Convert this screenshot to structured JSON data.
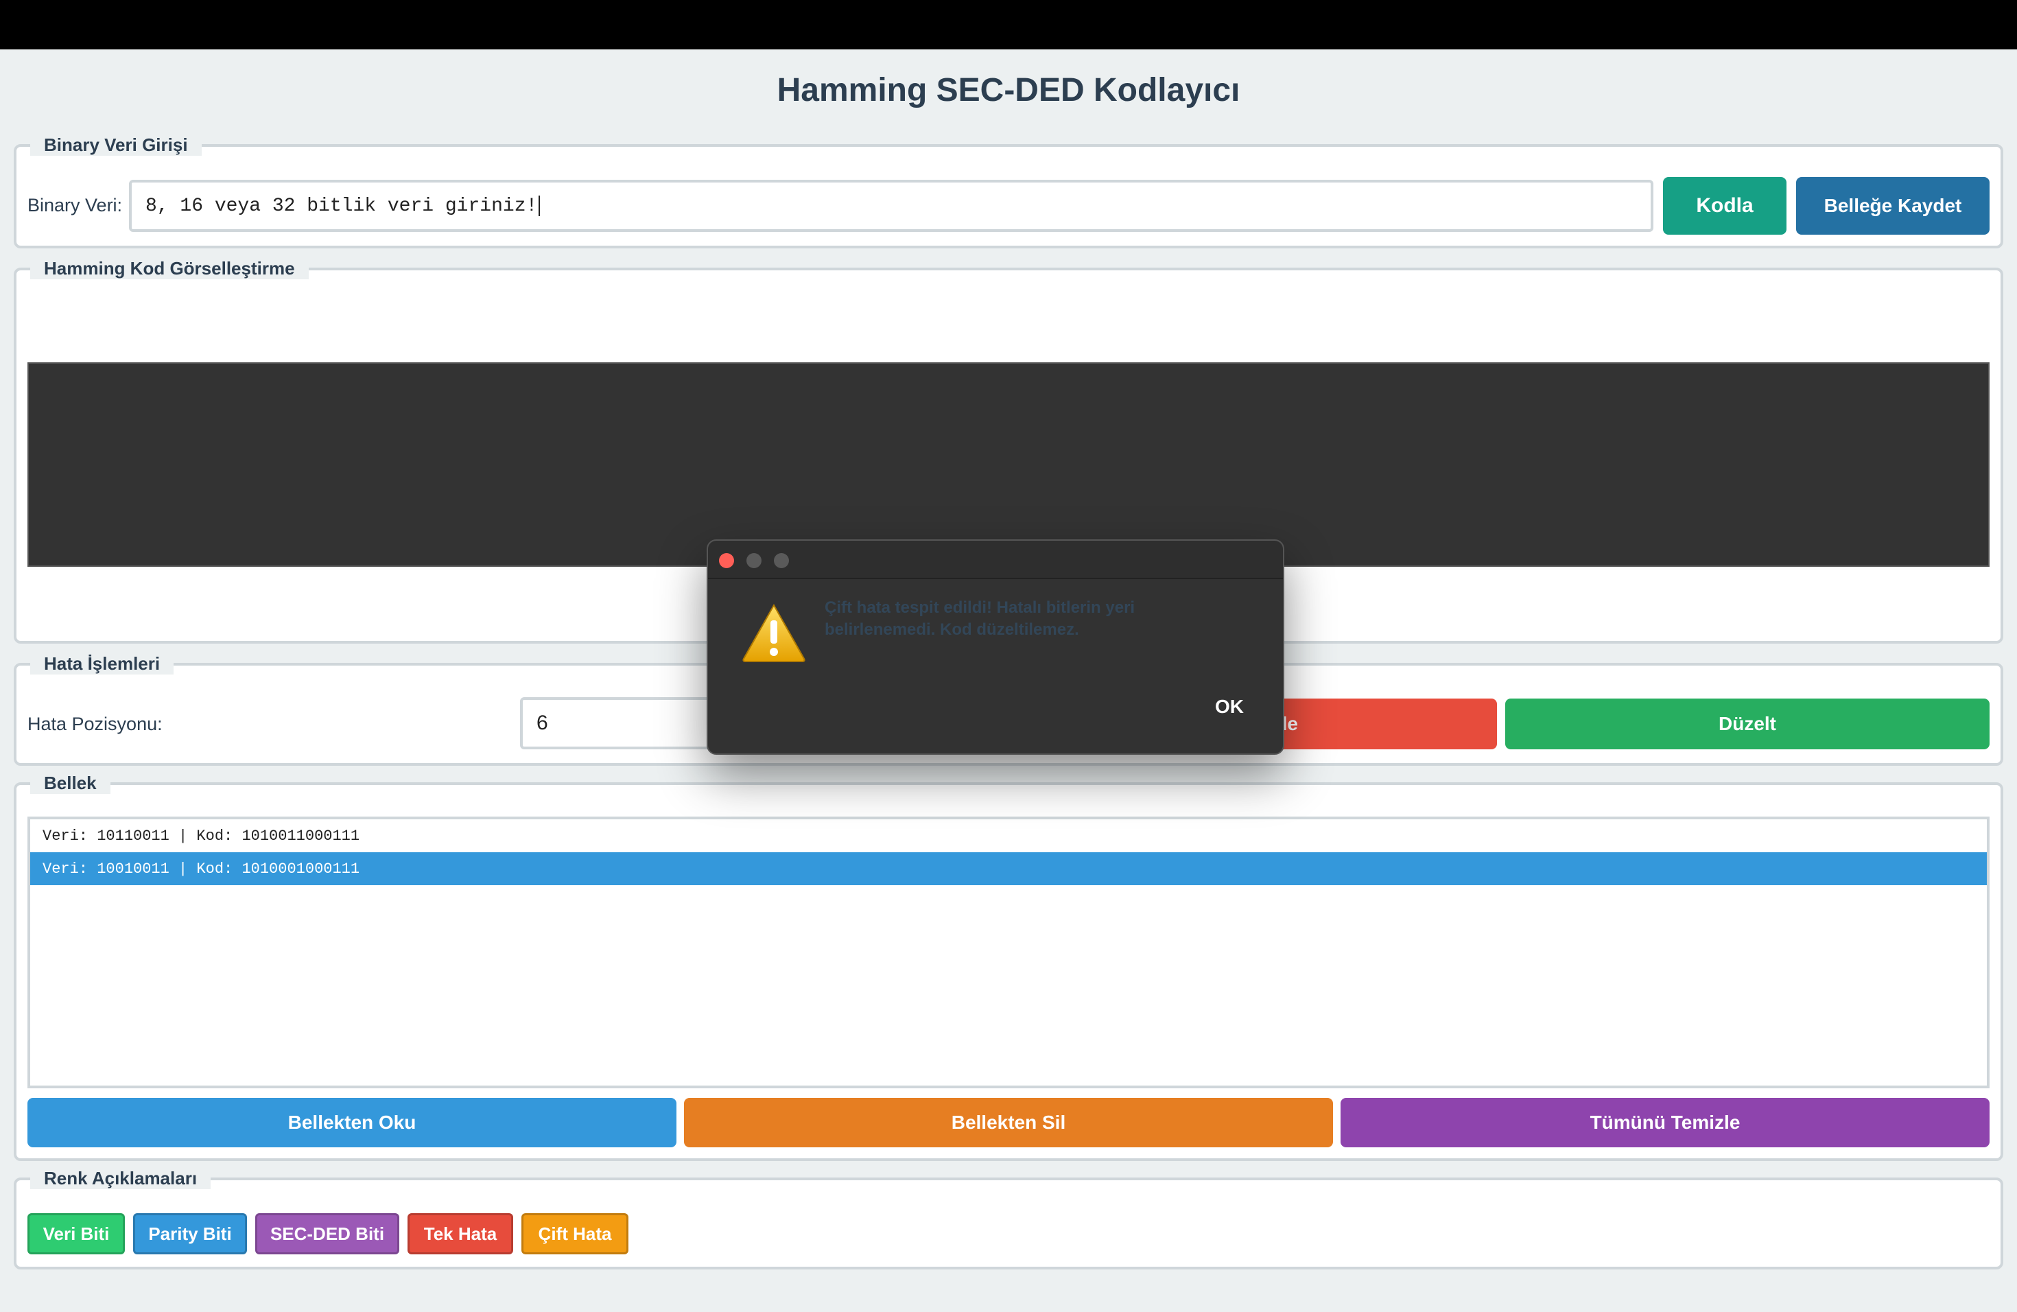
{
  "app": {
    "title": "Hamming SEC-DED Kodlayıcı"
  },
  "input_section": {
    "legend": "Binary Veri Girişi",
    "label": "Binary Veri:",
    "value": "8, 16 veya 32 bitlik veri giriniz!",
    "encode_button": "Kodla",
    "save_button": "Belleğe Kaydet"
  },
  "visual_section": {
    "legend": "Hamming Kod Görselleştirme"
  },
  "error_section": {
    "legend": "Hata İşlemleri",
    "label": "Hata Pozisyonu:",
    "position_value": "6",
    "add_error_button_partial": "le",
    "fix_button": "Düzelt"
  },
  "memory_section": {
    "legend": "Bellek",
    "items": [
      {
        "text": "Veri: 10110011 | Kod: 1010011000111",
        "selected": false
      },
      {
        "text": "Veri: 10010011 | Kod: 1010001000111",
        "selected": true
      }
    ],
    "read_button": "Bellekten Oku",
    "delete_button": "Bellekten Sil",
    "clear_button": "Tümünü Temizle"
  },
  "legend_section": {
    "legend": "Renk Açıklamaları",
    "chips": [
      {
        "label": "Veri Biti",
        "color": "#2ecc71"
      },
      {
        "label": "Parity Biti",
        "color": "#3498db"
      },
      {
        "label": "SEC-DED Biti",
        "color": "#9b59b6"
      },
      {
        "label": "Tek Hata",
        "color": "#e74c3c"
      },
      {
        "label": "Çift Hata",
        "color": "#f39c12"
      }
    ]
  },
  "dialog": {
    "message": "Çift hata tespit edildi! Hatalı bitlerin yeri belirlenemedi. Kod düzeltilemez.",
    "ok_button": "OK",
    "icon": "warning-icon"
  },
  "colors": {
    "teal": "#16a085",
    "blue": "#2471a3",
    "red": "#e74c3c",
    "green": "#27ae60",
    "mem_blue": "#3498db",
    "orange": "#e67e22",
    "purple": "#8e44ad",
    "dialog_bg": "#323232"
  }
}
